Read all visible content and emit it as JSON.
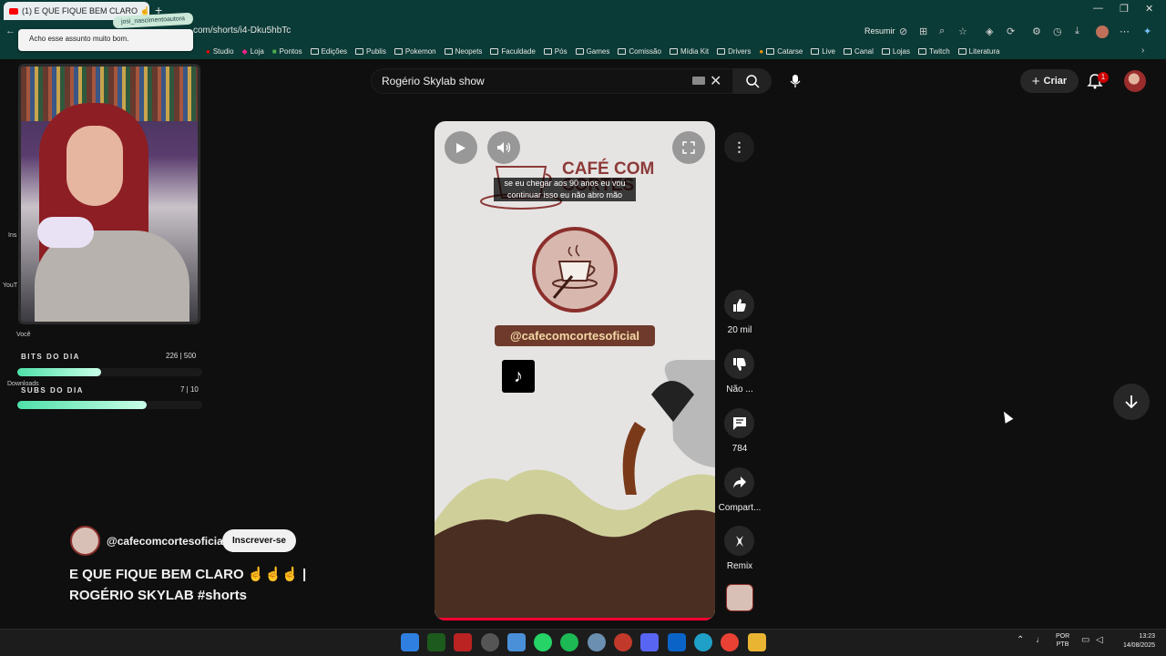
{
  "browser": {
    "tab_title": "(1) E QUE FIQUE BEM CLARO ☝☝",
    "url": "com/shorts/i4-Dku5hbTc",
    "resumir": "Resumir",
    "bookmarks": [
      "Studio",
      "Loja",
      "Pontos",
      "Edições",
      "Publis",
      "Pokemon",
      "Neopets",
      "Faculdade",
      "Pós",
      "Games",
      "Comissão",
      "Mídia Kit",
      "Drivers",
      "Catarse",
      "Live",
      "Canal",
      "Lojas",
      "Twitch",
      "Literatura"
    ],
    "tooltip": "Acho esse assunto muito bom."
  },
  "sidebar": {
    "labels": [
      "Ins",
      "YouT",
      "Você",
      "Downloads"
    ]
  },
  "overlay": {
    "name_tag": "josi_nascimentoautora",
    "bits_label": "BITS DO DIA",
    "bits_value": "226 | 500",
    "bits_fraction": 0.452,
    "subs_label": "SUBS DO DIA",
    "subs_value": "7 | 10",
    "subs_fraction": 0.7
  },
  "header": {
    "search_value": "Rogério Skylab show",
    "create_label": "Criar",
    "notification_count": "1"
  },
  "player": {
    "brand_title_1": "CAFÉ COM",
    "brand_title_2": "CORTES",
    "caption_line_1": "se eu chegar aos 90 anos eu vou",
    "caption_line_2": "continuar isso eu não abro mão",
    "handle_badge": "@cafecomcortesoficial"
  },
  "actions": {
    "likes": "20 mil",
    "dislike": "Não ...",
    "comments": "784",
    "share": "Compart...",
    "remix": "Remix"
  },
  "video": {
    "channel": "@cafecomcortesoficial",
    "subscribe": "Inscrever-se",
    "title": "E QUE FIQUE BEM CLARO ☝☝☝ | ROGÉRIO SKYLAB #shorts"
  },
  "taskbar": {
    "lang_1": "POR",
    "lang_2": "PTB",
    "time": "13:23",
    "date": "14/08/2025"
  },
  "colors": {
    "accent_red": "#ff0033",
    "chrome_teal": "#0b3b36",
    "brand_brown": "#8c3a38"
  }
}
